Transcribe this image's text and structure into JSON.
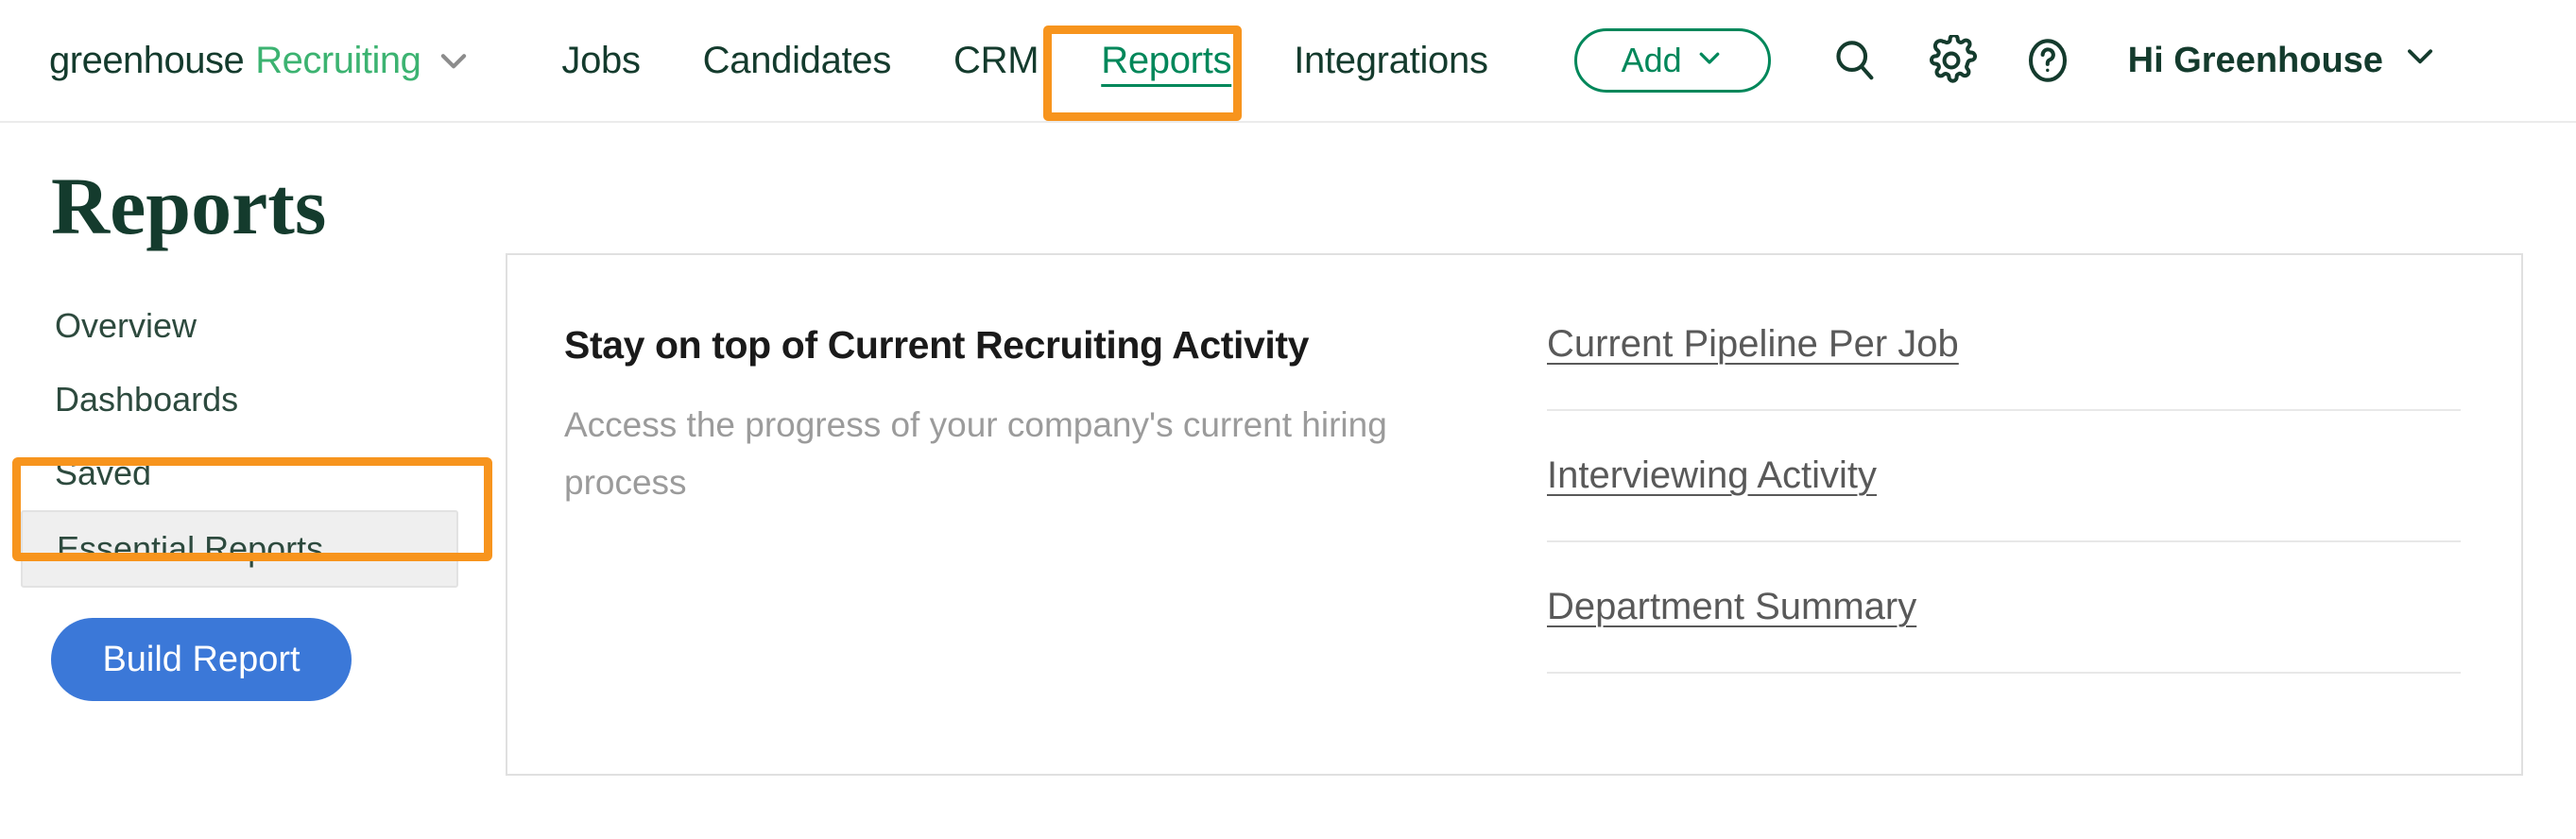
{
  "header": {
    "brand_primary": "greenhouse",
    "brand_secondary": "Recruiting",
    "brand_chevron_icon": "chevron-down-icon",
    "nav_items": [
      {
        "label": "Jobs",
        "active": false
      },
      {
        "label": "Candidates",
        "active": false
      },
      {
        "label": "CRM",
        "active": false
      },
      {
        "label": "Reports",
        "active": true
      },
      {
        "label": "Integrations",
        "active": false
      }
    ],
    "add_button": {
      "label": "Add",
      "chevron_icon": "chevron-down-icon"
    },
    "icons": [
      {
        "name": "search-icon"
      },
      {
        "name": "gear-icon"
      },
      {
        "name": "help-circle-icon"
      }
    ],
    "greeting": {
      "label": "Hi Greenhouse",
      "chevron_icon": "chevron-down-icon"
    }
  },
  "page": {
    "title": "Reports"
  },
  "sidebar": {
    "items": [
      {
        "label": "Overview",
        "selected": false
      },
      {
        "label": "Dashboards",
        "selected": false
      },
      {
        "label": "Saved",
        "selected": false
      },
      {
        "label": "Essential Reports",
        "selected": true
      }
    ],
    "build_report_button": "Build Report"
  },
  "card": {
    "heading": "Stay on top of Current Recruiting Activity",
    "subtext": "Access the progress of your company's current hiring process",
    "links": [
      "Current Pipeline Per Job",
      "Interviewing Activity",
      "Department Summary"
    ]
  },
  "annotations": {
    "highlight_color": "#f7941d",
    "targets": [
      "Reports",
      "Essential Reports"
    ]
  },
  "colors": {
    "brand_dark_green": "#143b2d",
    "brand_light_green": "#3cb371",
    "accent_green": "#00875a",
    "button_blue": "#3b78d8",
    "highlight_orange": "#f7941d"
  }
}
